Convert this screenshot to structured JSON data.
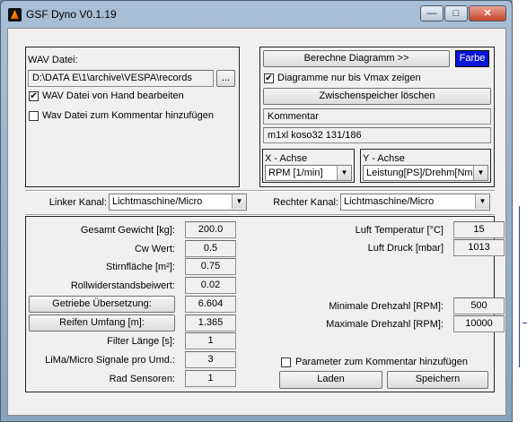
{
  "window": {
    "title": "GSF Dyno V0.1.19"
  },
  "wav": {
    "label": "WAV Datei:",
    "path": "D:\\DATA E\\1\\archive\\VESPA\\records",
    "browse": "...",
    "manual_edit_label": "WAV Datei von Hand bearbeiten",
    "manual_edit_checked": true,
    "add_comment_label": "Wav Datei zum Kommentar hinzufügen",
    "add_comment_checked": false
  },
  "diagram": {
    "calc_button": "Berechne Diagramm >>",
    "color_button": "Farbe",
    "vmax_label": "Diagramme nur bis Vmax zeigen",
    "vmax_checked": true,
    "clear_cache_button": "Zwischenspeicher löschen",
    "comment_label": "Kommentar",
    "comment_value": "m1xl koso32 131/186",
    "x_axis_label": "X - Achse",
    "x_axis_value": "RPM [1/min]",
    "y_axis_label": "Y - Achse",
    "y_axis_value": "Leistung[PS]/Drehm[Nm]"
  },
  "channels": {
    "left_label": "Linker Kanal:",
    "left_value": "Lichtmaschine/Micro",
    "right_label": "Rechter Kanal:",
    "right_value": "Lichtmaschine/Micro"
  },
  "params_left": [
    {
      "label": "Gesamt Gewicht [kg]:",
      "value": "200.0",
      "is_button": false
    },
    {
      "label": "Cw Wert:",
      "value": "0.5",
      "is_button": false
    },
    {
      "label": "Stirnfläche [m²]:",
      "value": "0.75",
      "is_button": false
    },
    {
      "label": "Rollwiderstandsbeiwert:",
      "value": "0.02",
      "is_button": false
    },
    {
      "label": "Getriebe Übersetzung:",
      "value": "6.604",
      "is_button": true
    },
    {
      "label": "Reifen Umfang [m]:",
      "value": "1.365",
      "is_button": true
    },
    {
      "label": "Filter Länge [s]:",
      "value": "1",
      "is_button": false
    },
    {
      "label": "LiMa/Micro Signale pro Umd.:",
      "value": "3",
      "is_button": false
    },
    {
      "label": "Rad Sensoren:",
      "value": "1",
      "is_button": false
    }
  ],
  "params_right": {
    "temp_label": "Luft Temperatur [°C]",
    "temp_value": "15",
    "pressure_label": "Luft Druck [mbar]",
    "pressure_value": "1013",
    "min_rpm_label": "Minimale Drehzahl [RPM]:",
    "min_rpm_value": "500",
    "max_rpm_label": "Maximale Drehzahl [RPM]:",
    "max_rpm_value": "10000",
    "add_params_label": "Parameter zum Kommentar hinzufügen",
    "add_params_checked": false,
    "load_button": "Laden",
    "save_button": "Speichern"
  },
  "colors": {
    "accent": "#0a17d6"
  }
}
